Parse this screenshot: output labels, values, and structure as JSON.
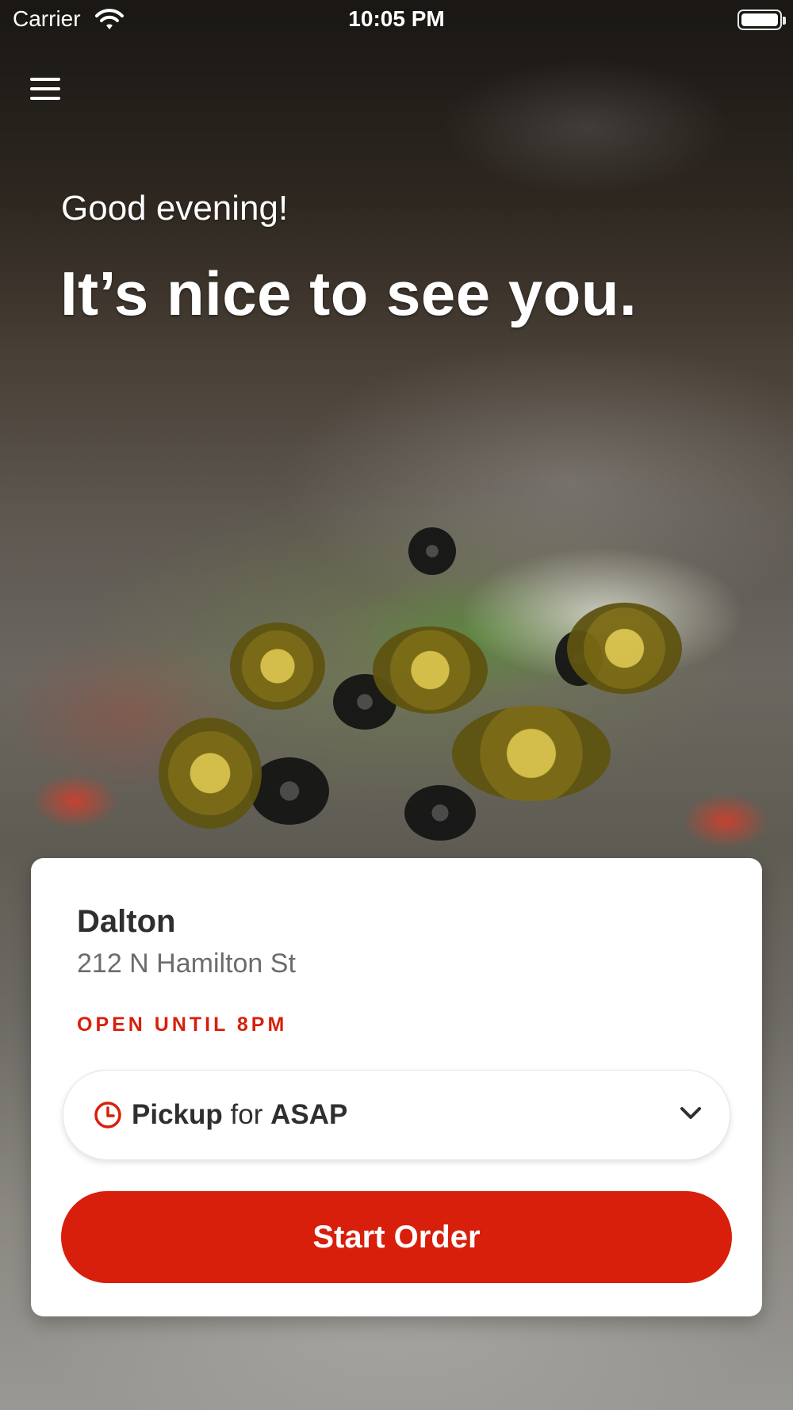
{
  "status_bar": {
    "carrier": "Carrier",
    "time": "10:05 PM",
    "wifi_icon": "wifi-icon",
    "battery_icon": "battery-icon"
  },
  "header": {
    "menu_icon": "hamburger-menu-icon"
  },
  "hero": {
    "greeting": "Good evening!",
    "headline": "It’s nice to see you."
  },
  "store_card": {
    "name": "Dalton",
    "address": "212 N Hamilton St",
    "hours": "OPEN UNTIL 8PM",
    "order_type": {
      "mode": "Pickup",
      "connector": "for",
      "time": "ASAP",
      "icon": "clock-icon",
      "dropdown_icon": "chevron-down-icon"
    },
    "start_button_label": "Start Order"
  },
  "colors": {
    "brand_red": "#d81f0b",
    "text_dark": "#2f2f2f",
    "text_muted": "#6c6c6c",
    "card_bg": "#ffffff"
  }
}
